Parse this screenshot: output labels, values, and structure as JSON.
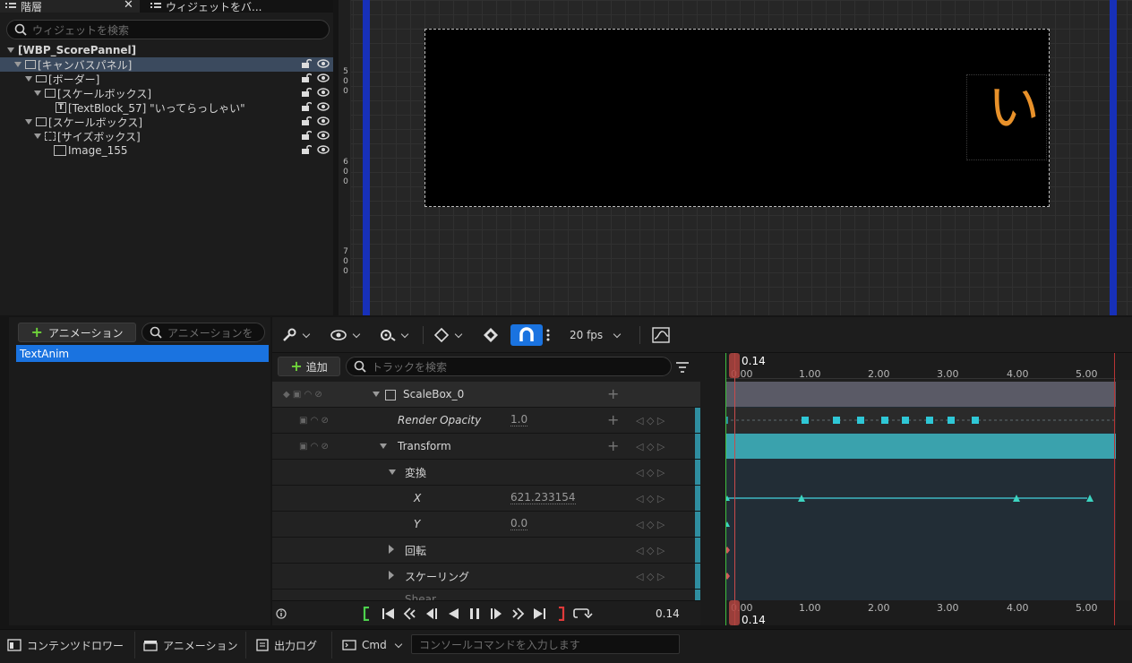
{
  "hierarchy": {
    "tabs": [
      {
        "label": "階層"
      },
      {
        "label": "ウィジェットをバ..."
      }
    ],
    "search_placeholder": "ウィジェットを検索",
    "rows": [
      {
        "label": "[WBP_ScorePannel]"
      },
      {
        "label": "[キャンバスパネル]"
      },
      {
        "label": "[ボーダー]"
      },
      {
        "label": "[スケールボックス]"
      },
      {
        "label": "[TextBlock_57] \"いってらっしゃい\""
      },
      {
        "label": "[スケールボックス]"
      },
      {
        "label": "[サイズボックス]"
      },
      {
        "label": "Image_155"
      }
    ]
  },
  "canvas": {
    "ruler_labels": [
      "5",
      "0",
      "0",
      "6",
      "0",
      "0",
      "7",
      "0",
      "0"
    ],
    "preview_text": "い"
  },
  "animations": {
    "add_label": "アニメーション",
    "search_placeholder": "アニメーションを",
    "items": [
      "TextAnim"
    ]
  },
  "sequencer": {
    "fps_label": "20 fps",
    "add_label": "追加",
    "search_placeholder": "トラックを検索",
    "tracks": [
      {
        "label": "ScaleBox_0"
      },
      {
        "label": "Render Opacity",
        "value": "1.0"
      },
      {
        "label": "Transform"
      },
      {
        "label": "変換"
      },
      {
        "label": "X",
        "value": "621.233154"
      },
      {
        "label": "Y",
        "value": "0.0"
      },
      {
        "label": "回転"
      },
      {
        "label": "スケーリング"
      },
      {
        "label": "Shear"
      }
    ],
    "current_time": "0.14",
    "ruler_ticks": [
      "0.00",
      "1.00",
      "2.00",
      "3.00",
      "4.00",
      "5.00"
    ]
  },
  "statusbar": {
    "content_drawer": "コンテンツドロワー",
    "animation": "アニメーション",
    "output_log": "出力ログ",
    "cmd": "Cmd",
    "console_placeholder": "コンソールコマンドを入力します"
  }
}
